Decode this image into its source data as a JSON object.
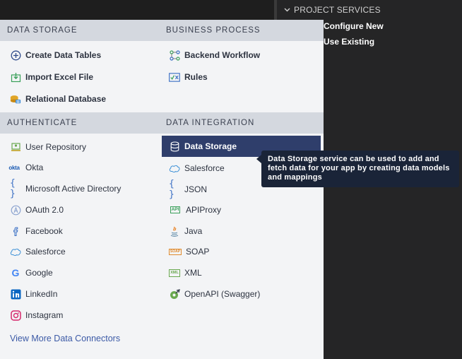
{
  "project_services": {
    "header": "PROJECT SERVICES",
    "items": [
      "Configure New",
      "Use Existing"
    ]
  },
  "sections": {
    "data_storage": {
      "title": "DATA STORAGE",
      "items": [
        "Create Data Tables",
        "Import Excel File",
        "Relational Database"
      ]
    },
    "business_process": {
      "title": "BUSINESS PROCESS",
      "items": [
        "Backend Workflow",
        "Rules"
      ]
    },
    "authenticate": {
      "title": "AUTHENTICATE",
      "items": [
        "User Repository",
        "Okta",
        "Microsoft Active Directory",
        "OAuth 2.0",
        "Facebook",
        "Salesforce",
        "Google",
        "LinkedIn",
        "Instagram"
      ]
    },
    "data_integration": {
      "title": "DATA INTEGRATION",
      "items": [
        "Data Storage",
        "Salesforce",
        "JSON",
        "APIProxy",
        "Java",
        "SOAP",
        "XML",
        "OpenAPI (Swagger)"
      ]
    }
  },
  "view_more": "View More Data Connectors",
  "tooltip": "Data Storage service can be used to add and fetch data for your app by creating data models and mappings",
  "icon_glyphs": {
    "okta": "okta",
    "brace": "{ }",
    "google": "G",
    "api": "API",
    "soap": "SOAP",
    "xml": "XML",
    "rules": "✓x"
  },
  "colors": {
    "selected_bg": "#2f3e6b",
    "tooltip_bg": "#1a2438",
    "section_header_bg": "#d4d8df",
    "link": "#3c5aa6"
  }
}
